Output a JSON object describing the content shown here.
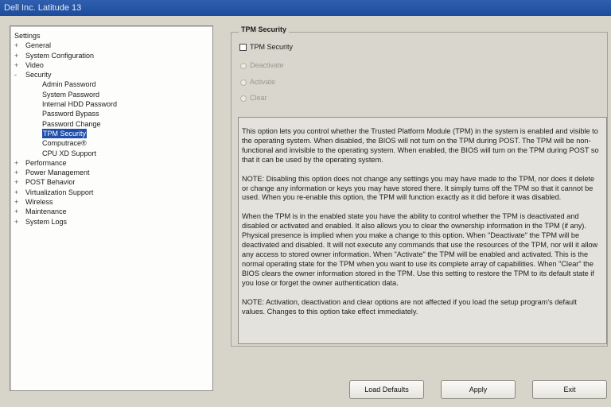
{
  "window": {
    "title": "Dell Inc. Latitude 13"
  },
  "tree": {
    "root_label": "Settings",
    "items": [
      {
        "label": "General",
        "expander": "+"
      },
      {
        "label": "System Configuration",
        "expander": "+"
      },
      {
        "label": "Video",
        "expander": "+"
      },
      {
        "label": "Security",
        "expander": "-"
      },
      {
        "label": "Admin Password",
        "child": true
      },
      {
        "label": "System Password",
        "child": true
      },
      {
        "label": "Internal HDD Password",
        "child": true
      },
      {
        "label": "Password Bypass",
        "child": true
      },
      {
        "label": "Password Change",
        "child": true
      },
      {
        "label": "TPM Security",
        "child": true,
        "selected": true
      },
      {
        "label": "Computrace®",
        "child": true
      },
      {
        "label": "CPU XD Support",
        "child": true
      },
      {
        "label": "Performance",
        "expander": "+"
      },
      {
        "label": "Power Management",
        "expander": "+"
      },
      {
        "label": "POST Behavior",
        "expander": "+"
      },
      {
        "label": "Virtualization Support",
        "expander": "+"
      },
      {
        "label": "Wireless",
        "expander": "+"
      },
      {
        "label": "Maintenance",
        "expander": "+"
      },
      {
        "label": "System Logs",
        "expander": "+"
      }
    ]
  },
  "panel": {
    "title": "TPM Security",
    "checkbox_label": "TPM Security",
    "checkbox_checked": false,
    "radios": [
      {
        "label": "Deactivate"
      },
      {
        "label": "Activate"
      },
      {
        "label": "Clear"
      }
    ],
    "description": [
      "This option lets you control whether the Trusted Platform Module (TPM) in the system is enabled and visible to the operating system. When disabled, the BIOS will not turn on the TPM during POST. The TPM will be non-functional and invisible to the operating system. When enabled, the BIOS will turn on the TPM during POST so that it can be used by the operating system.",
      "NOTE: Disabling this option does not change any settings you may have made to the TPM, nor does it delete or change any information or keys you may have stored there. It simply turns off the TPM so that it cannot be used. When you re-enable this option, the TPM will function exactly as it did before it was disabled.",
      "When the TPM is in the enabled state you have the ability to control whether the TPM is deactivated and disabled or activated and enabled.  It also allows you to clear the ownership information in the TPM (if any). Physical presence is implied when you make a change to this option. When \"Deactivate\" the TPM will be deactivated and disabled. It will not execute any commands that use the resources of the TPM, nor will it allow any access to stored owner information. When \"Activate\" the TPM will be enabled and activated. This is the normal operating state for the TPM when you want to use its complete array of capabilities. When \"Clear\" the BIOS clears the owner information stored in the TPM. Use this setting to restore the TPM to its default state if you lose or forget the owner authentication data.",
      "NOTE: Activation, deactivation and clear options are not affected if you load the setup program's default values. Changes to this option take effect immediately."
    ]
  },
  "buttons": {
    "load_defaults": "Load Defaults",
    "apply": "Apply",
    "exit": "Exit"
  }
}
